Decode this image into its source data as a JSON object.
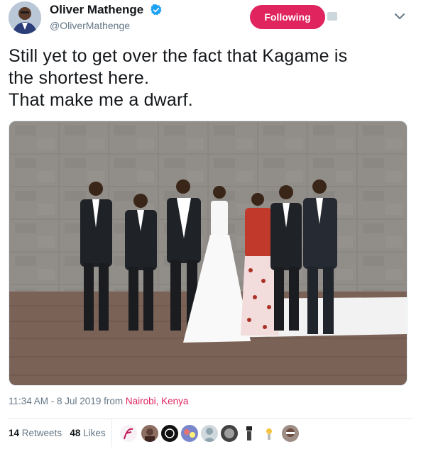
{
  "user": {
    "display_name": "Oliver Mathenge",
    "handle": "@OliverMathenge"
  },
  "follow_button": {
    "label": "Following"
  },
  "tweet": {
    "lines": [
      "Still yet to get over the fact that Kagame is",
      "the shortest here.",
      "That make me a dwarf."
    ]
  },
  "meta": {
    "time_date": "11:34 AM - 8 Jul 2019",
    "from_label": "from",
    "location": "Nairobi, Kenya"
  },
  "stats": {
    "retweets_count": "14",
    "retweets_label": "Retweets",
    "likes_count": "48",
    "likes_label": "Likes"
  },
  "colors": {
    "accent": "#e0245e",
    "verified": "#1da1f2",
    "secondary_text": "#657786"
  }
}
